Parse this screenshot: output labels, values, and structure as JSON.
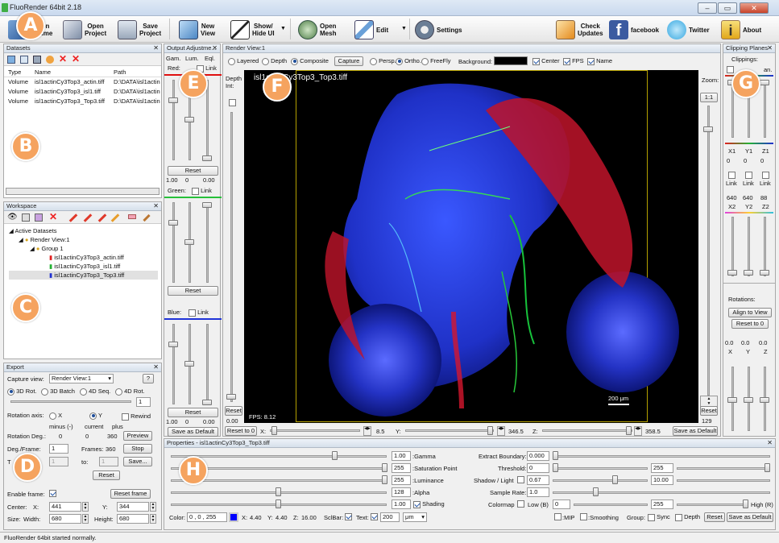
{
  "window": {
    "title": "FluoRender 64bit 2.18"
  },
  "toolbar": {
    "buttons": [
      {
        "id": "open-volume",
        "label": "Open\nVolume"
      },
      {
        "id": "open-project",
        "label": "Open\nProject"
      },
      {
        "id": "save-project",
        "label": "Save\nProject"
      },
      {
        "id": "new-view",
        "label": "New\nView"
      },
      {
        "id": "show-hide-ui",
        "label": "Show/\nHide UI"
      },
      {
        "id": "open-mesh",
        "label": "Open\nMesh"
      },
      {
        "id": "edit",
        "label": "Edit"
      },
      {
        "id": "settings",
        "label": "Settings"
      },
      {
        "id": "check-updates",
        "label": "Check\nUpdates"
      },
      {
        "id": "facebook",
        "label": "facebook"
      },
      {
        "id": "twitter",
        "label": "Twitter"
      },
      {
        "id": "about",
        "label": "About"
      }
    ]
  },
  "badges": [
    "A",
    "B",
    "C",
    "D",
    "E",
    "F",
    "G",
    "H"
  ],
  "datasets": {
    "title": "Datasets",
    "columns": [
      "Type",
      "Name",
      "Path"
    ],
    "rows": [
      [
        "Volume",
        "isl1actinCy3Top3_actin.tiff",
        "D:\\DATA\\isl1actin"
      ],
      [
        "Volume",
        "isl1actinCy3Top3_isl1.tiff",
        "D:\\DATA\\isl1actin"
      ],
      [
        "Volume",
        "isl1actinCy3Top3_Top3.tiff",
        "D:\\DATA\\isl1actin"
      ]
    ]
  },
  "workspace": {
    "title": "Workspace",
    "active": "Active Datasets",
    "view": "Render View:1",
    "group": "Group 1",
    "items": [
      "isl1actinCy3Top3_actin.tiff",
      "isl1actinCy3Top3_isl1.tiff",
      "isl1actinCy3Top3_Top3.tiff"
    ]
  },
  "export": {
    "title": "Export",
    "capture_view_label": "Capture view:",
    "capture_view_value": "Render View:1",
    "help": "?",
    "modes": [
      "3D Rot.",
      "3D Batch",
      "4D Seq.",
      "4D Rot."
    ],
    "rot_value": "1",
    "rotation_axis_label": "Rotation axis:",
    "axis_x": "X",
    "axis_y": "Y",
    "rewind": "Rewind",
    "minus_label": "minus (-)",
    "current_label": "current",
    "plus_label": "plus",
    "rotation_deg_label": "Rotation Deg.:",
    "rotation_minus": "0",
    "rotation_current": "0",
    "rotation_plus": "360",
    "preview": "Preview",
    "deg_frame_label": "Deg./Frame:",
    "deg_frame": "1",
    "frames_label": "Frames:",
    "frames": "360",
    "stop": "Stop",
    "t_label": "T",
    "t_value": "1",
    "to_label": "to:",
    "to_value": "1",
    "save": "Save...",
    "reset": "Reset",
    "enable_frame": "Enable frame:",
    "reset_frame": "Reset frame",
    "center_label": "Center:",
    "center_x_label": "X:",
    "center_x": "441",
    "center_y_label": "Y:",
    "center_y": "344",
    "size_label": "Size:",
    "width_label": "Width:",
    "width": "680",
    "height_label": "Height:",
    "height": "680"
  },
  "output": {
    "title": "Output Adjustme...",
    "cols": [
      "Gam.",
      "Lum.",
      "Eql."
    ],
    "red_label": "Red:",
    "green_label": "Green:",
    "blue_label": "Blue:",
    "link": "Link",
    "reset": "Reset",
    "values": [
      "1.00",
      "0",
      "0.00"
    ],
    "save_default": "Save as Default",
    "colors": {
      "red": "#e01010",
      "green": "#27c03a",
      "blue": "#2034d8"
    }
  },
  "render": {
    "title": "Render View:1",
    "modes": [
      "Layered",
      "Depth",
      "Composite"
    ],
    "capture": "Capture",
    "proj": [
      "Persp.",
      "Ortho.",
      "FreeFly"
    ],
    "background_label": "Background:",
    "opts": [
      "Center",
      "FPS",
      "Name"
    ],
    "depth_label": "Depth\nInt:",
    "zoom_label": "Zoom:",
    "zoom_value": "1:1",
    "dataset_name": "isl1actinCy3Top3_Top3.tiff",
    "fps": "FPS: 8.12",
    "scale": "200 μm",
    "reset_label": "Reset",
    "left_value": "0.00",
    "reset_to_0": "Reset to 0",
    "x_label": "X:",
    "x_value": "8.5",
    "y_label": "Y:",
    "y_value": "346.5",
    "z_label": "Z:",
    "z_value": "358.5",
    "save_default": "Save as Default",
    "right_reset": "Reset",
    "right_value": "129"
  },
  "clipping": {
    "title": "Clipping Planes",
    "clippings": "Clippings:",
    "tan": "an.",
    "x1": "X1",
    "y1": "Y1",
    "z1": "Z1",
    "v1": [
      "0",
      "0",
      "0"
    ],
    "link": "Link",
    "v2": [
      "640",
      "640",
      "88"
    ],
    "x2": "X2",
    "y2": "Y2",
    "z2": "Z2",
    "rotations": "Rotations:",
    "align": "Align to View",
    "reset0": "Reset to 0",
    "rot_values": [
      "0.0",
      "0.0",
      "0.0"
    ],
    "rot_axes": [
      "X",
      "Y",
      "Z"
    ]
  },
  "properties": {
    "title": "Properties - isl1actinCy3Top3_Top3.tiff",
    "left": [
      {
        "value": "1.00",
        "label": ":Gamma"
      },
      {
        "value": "255",
        "label": ":Saturation Point"
      },
      {
        "value": "255",
        "label": ":Luminance"
      },
      {
        "value": "128",
        "label": ":Alpha"
      },
      {
        "value": "1.00",
        "label": "Shading"
      }
    ],
    "extract_label": "Extract Boundary:",
    "extract": "0.000",
    "threshold_label": "Threshold:",
    "threshold_low": "0",
    "threshold_high": "255",
    "shadow_label": "Shadow / Light",
    "shadow": "0.67",
    "light": "10.00",
    "sample_label": "Sample Rate:",
    "sample": "1.0",
    "colormap_label": "Colormap",
    "low_label": "Low (B)",
    "cmap_low": "0",
    "cmap_high": "255",
    "high_label": "High (R)",
    "color_label": "Color:",
    "color_value": "0 , 0 , 255",
    "px_label": "X:",
    "px": "4.40",
    "py_label": "Y:",
    "py": "4.40",
    "pz_label": "Z:",
    "pz": "16.00",
    "sclbar": "SclBar:",
    "text": "Text:",
    "text_value": "200",
    "unit": "μm",
    "mip": ":MIP",
    "smoothing": ":Smoothing",
    "group": "Group:",
    "sync": "Sync",
    "depth": "Depth",
    "reset": "Reset",
    "save_default": "Save as Default"
  },
  "status": "FluoRender 64bit started normally."
}
